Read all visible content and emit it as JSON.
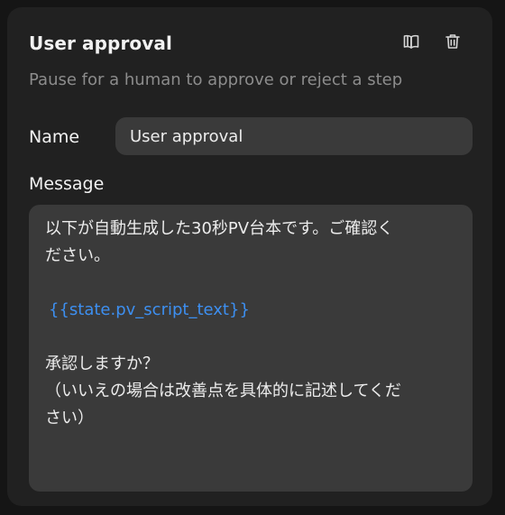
{
  "header": {
    "title": "User approval",
    "subtitle": "Pause for a human to approve or reject a step",
    "icons": [
      "book-icon",
      "trash-icon"
    ]
  },
  "form": {
    "name_label": "Name",
    "name_value": "User approval",
    "message_label": "Message",
    "message_lines": [
      "以下が自動生成した30秒PV台本です。ご確認く",
      "ださい。",
      "",
      "{{state.pv_script_text}}",
      "",
      "承認しますか？",
      "（いいえの場合は改善点を具体的に記述してくだ",
      "さい）"
    ]
  },
  "colors": {
    "panel_bg": "#212121",
    "input_bg": "#3a3a3a",
    "variable": "#3d8ff0",
    "subtitle": "#8c8c8c"
  }
}
